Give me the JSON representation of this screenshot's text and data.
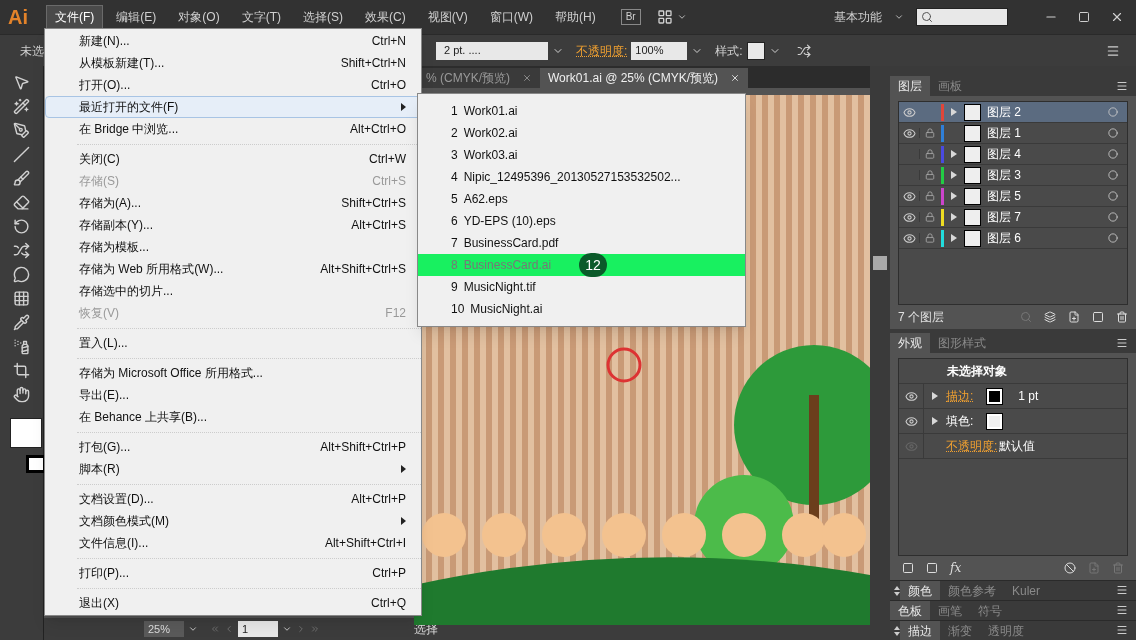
{
  "app": {
    "logo": "Ai",
    "workspace": "基本功能",
    "bridge_button": "Br"
  },
  "menus": [
    {
      "label": "文件(F)",
      "selected": true
    },
    {
      "label": "编辑(E)",
      "selected": false
    },
    {
      "label": "对象(O)",
      "selected": false
    },
    {
      "label": "文字(T)",
      "selected": false
    },
    {
      "label": "选择(S)",
      "selected": false
    },
    {
      "label": "效果(C)",
      "selected": false
    },
    {
      "label": "视图(V)",
      "selected": false
    },
    {
      "label": "窗口(W)",
      "selected": false
    },
    {
      "label": "帮助(H)",
      "selected": false
    }
  ],
  "control_bar": {
    "selection": "未选",
    "stroke_weight": "2 pt. ....",
    "opacity_label": "不透明度:",
    "opacity": "100%",
    "style_label": "样式:"
  },
  "document_tabs": [
    {
      "title": "% (CMYK/预览)",
      "selected": false
    },
    {
      "title": "Work01.ai @ 25% (CMYK/预览)",
      "selected": true
    }
  ],
  "file_menu": [
    [
      {
        "label": "新建(N)...",
        "shortcut": "Ctrl+N",
        "disabled": false,
        "submenu": false,
        "selected": false
      },
      {
        "label": "从模板新建(T)...",
        "shortcut": "Shift+Ctrl+N",
        "disabled": false,
        "submenu": false,
        "selected": false
      },
      {
        "label": "打开(O)...",
        "shortcut": "Ctrl+O",
        "disabled": false,
        "submenu": false,
        "selected": false
      },
      {
        "label": "最近打开的文件(F)",
        "disabled": false,
        "submenu": true,
        "selected": true
      },
      {
        "label": "在 Bridge 中浏览...",
        "shortcut": "Alt+Ctrl+O",
        "disabled": false,
        "submenu": false,
        "selected": false
      }
    ],
    [
      {
        "label": "关闭(C)",
        "shortcut": "Ctrl+W",
        "disabled": false,
        "submenu": false,
        "selected": false
      },
      {
        "label": "存储(S)",
        "shortcut": "Ctrl+S",
        "disabled": true,
        "submenu": false,
        "selected": false
      },
      {
        "label": "存储为(A)...",
        "shortcut": "Shift+Ctrl+S",
        "disabled": false,
        "submenu": false,
        "selected": false
      },
      {
        "label": "存储副本(Y)...",
        "shortcut": "Alt+Ctrl+S",
        "disabled": false,
        "submenu": false,
        "selected": false
      },
      {
        "label": "存储为模板...",
        "disabled": false,
        "submenu": false,
        "selected": false
      },
      {
        "label": "存储为 Web 所用格式(W)...",
        "shortcut": "Alt+Shift+Ctrl+S",
        "disabled": false,
        "submenu": false,
        "selected": false
      },
      {
        "label": "存储选中的切片...",
        "disabled": false,
        "submenu": false,
        "selected": false
      },
      {
        "label": "恢复(V)",
        "shortcut": "F12",
        "disabled": true,
        "submenu": false,
        "selected": false
      }
    ],
    [
      {
        "label": "置入(L)...",
        "disabled": false,
        "submenu": false,
        "selected": false
      }
    ],
    [
      {
        "label": "存储为 Microsoft Office 所用格式...",
        "disabled": false,
        "submenu": false,
        "selected": false
      },
      {
        "label": "导出(E)...",
        "disabled": false,
        "submenu": false,
        "selected": false
      },
      {
        "label": "在 Behance 上共享(B)...",
        "disabled": false,
        "submenu": false,
        "selected": false
      }
    ],
    [
      {
        "label": "打包(G)...",
        "shortcut": "Alt+Shift+Ctrl+P",
        "disabled": false,
        "submenu": false,
        "selected": false
      },
      {
        "label": "脚本(R)",
        "disabled": false,
        "submenu": true,
        "selected": false
      }
    ],
    [
      {
        "label": "文档设置(D)...",
        "shortcut": "Alt+Ctrl+P",
        "disabled": false,
        "submenu": false,
        "selected": false
      },
      {
        "label": "文档颜色模式(M)",
        "disabled": false,
        "submenu": true,
        "selected": false
      },
      {
        "label": "文件信息(I)...",
        "shortcut": "Alt+Shift+Ctrl+I",
        "disabled": false,
        "submenu": false,
        "selected": false
      }
    ],
    [
      {
        "label": "打印(P)...",
        "shortcut": "Ctrl+P",
        "disabled": false,
        "submenu": false,
        "selected": false
      }
    ],
    [
      {
        "label": "退出(X)",
        "shortcut": "Ctrl+Q",
        "disabled": false,
        "submenu": false,
        "selected": false
      }
    ]
  ],
  "recent_files": {
    "step_badge": "12",
    "items": [
      {
        "number": "1",
        "name": "Work01.ai",
        "selected": false
      },
      {
        "number": "2",
        "name": "Work02.ai",
        "selected": false
      },
      {
        "number": "3",
        "name": "Work03.ai",
        "selected": false
      },
      {
        "number": "4",
        "name": "Nipic_12495396_20130527153532502...",
        "selected": false
      },
      {
        "number": "5",
        "name": "A62.eps",
        "selected": false
      },
      {
        "number": "6",
        "name": "YD-EPS (10).eps",
        "selected": false
      },
      {
        "number": "7",
        "name": "BusinessCard.pdf",
        "selected": false
      },
      {
        "number": "8",
        "name": "BusinessCard.ai",
        "selected": true
      },
      {
        "number": "9",
        "name": "MusicNight.tif",
        "selected": false
      },
      {
        "number": "10",
        "name": "MusicNight.ai",
        "selected": false
      }
    ]
  },
  "layers_panel": {
    "tabs": [
      {
        "label": "图层",
        "selected": true
      },
      {
        "label": "画板",
        "selected": false
      }
    ],
    "layers": [
      {
        "name": "图层 2",
        "visible": true,
        "locked": false,
        "expandable": true,
        "color": "#e0463a",
        "selected": true
      },
      {
        "name": "图层 1",
        "visible": true,
        "locked": true,
        "expandable": false,
        "color": "#2f7fd8",
        "selected": false
      },
      {
        "name": "图层 4",
        "visible": false,
        "locked": true,
        "expandable": true,
        "color": "#4a4ae0",
        "selected": false
      },
      {
        "name": "图层 3",
        "visible": false,
        "locked": true,
        "expandable": true,
        "color": "#22cc44",
        "selected": false
      },
      {
        "name": "图层 5",
        "visible": true,
        "locked": true,
        "expandable": true,
        "color": "#cc44cc",
        "selected": false
      },
      {
        "name": "图层 7",
        "visible": true,
        "locked": true,
        "expandable": true,
        "color": "#eedd22",
        "selected": false
      },
      {
        "name": "图层 6",
        "visible": true,
        "locked": true,
        "expandable": true,
        "color": "#22dddd",
        "selected": false
      }
    ],
    "count": "7 个图层"
  },
  "appearance_panel": {
    "tabs": [
      {
        "label": "外观",
        "selected": true
      },
      {
        "label": "图形样式",
        "selected": false
      }
    ],
    "title": "未选择对象",
    "fx_button": "fx",
    "rows": [
      {
        "kind": "swatch",
        "label": "描边:",
        "color": "#000000",
        "value": "1 pt",
        "visible": true,
        "expandable": true,
        "linked": true
      },
      {
        "kind": "swatch",
        "label": "填色:",
        "color": "#f0f0f0",
        "visible": true,
        "expandable": true,
        "linked": false
      },
      {
        "kind": "value",
        "label": "不透明度:",
        "value": "默认值",
        "visible": false,
        "expandable": false,
        "linked": true
      }
    ]
  },
  "panel_groups": [
    {
      "collapsible": true,
      "tabs": [
        {
          "label": "颜色",
          "selected": true
        },
        {
          "label": "颜色参考",
          "selected": false
        },
        {
          "label": "Kuler",
          "selected": false
        }
      ]
    },
    {
      "collapsible": false,
      "tabs": [
        {
          "label": "色板",
          "selected": true
        },
        {
          "label": "画笔",
          "selected": false
        },
        {
          "label": "符号",
          "selected": false
        }
      ]
    },
    {
      "collapsible": true,
      "tabs": [
        {
          "label": "描边",
          "selected": true
        },
        {
          "label": "渐变",
          "selected": false
        },
        {
          "label": "透明度",
          "selected": false
        }
      ]
    }
  ],
  "status_bar": {
    "zoom": "25%",
    "page": "1",
    "tool": "选择"
  }
}
